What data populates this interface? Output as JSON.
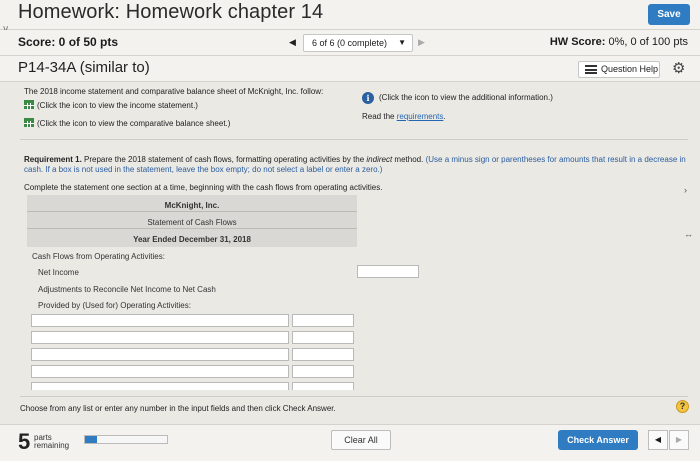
{
  "header": {
    "title": "Homework: Homework chapter 14",
    "save_label": "Save"
  },
  "score_bar": {
    "score": "Score: 0 of 50 pts",
    "question_selector": "6 of 6 (0 complete)",
    "hw_score_label": "HW Score:",
    "hw_score_value": "0%, 0 of 100 pts"
  },
  "problem": {
    "title": "P14-34A (similar to)",
    "help_label": "Question Help"
  },
  "intro": {
    "line1": "The 2018 income statement and comparative balance sheet of McKnight, Inc. follow:",
    "income_link": "(Click the icon to view the income statement.)",
    "balance_link": "(Click the icon to view the comparative balance sheet.)",
    "info_text": "(Click the icon to view the additional information.)",
    "read_prefix": "Read the ",
    "read_link": "requirements",
    "read_suffix": "."
  },
  "requirement": {
    "bold": "Requirement 1.",
    "text": "Prepare the 2018 statement of cash flows, formatting operating activities by the ",
    "italic": "indirect",
    "text2": " method.",
    "hint": "(Use a minus sign or parentheses for amounts that result in a decrease in cash. If a box is not used in the statement, leave the box empty; do not select a label or enter a zero.)",
    "complete": "Complete the statement one section at a time, beginning with the cash flows from operating activities."
  },
  "statement": {
    "company": "McKnight, Inc.",
    "name": "Statement of Cash Flows",
    "period": "Year Ended December 31, 2018",
    "section": "Cash Flows from Operating Activities:",
    "net_income": "Net Income",
    "adjust1": "Adjustments to Reconcile Net Income to Net Cash",
    "adjust2": "Provided by (Used for) Operating Activities:"
  },
  "instructions": {
    "choose": "Choose from any list or enter any number in the input fields and then click Check Answer."
  },
  "footer": {
    "parts_count": "5",
    "parts_line1": "parts",
    "parts_line2": "remaining",
    "progress": 0.15,
    "clear_label": "Clear All",
    "check_label": "Check Answer"
  },
  "colors": {
    "accent": "#2f7cc2",
    "icon_green": "#3a8a46",
    "link_blue": "#2566b4"
  }
}
